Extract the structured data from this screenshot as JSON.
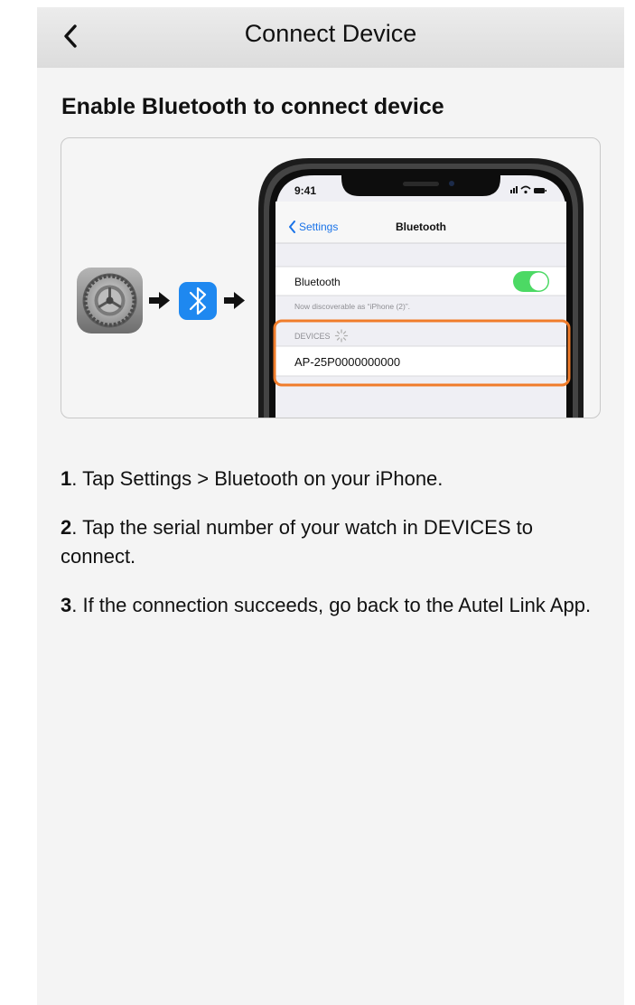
{
  "navbar": {
    "title": "Connect Device",
    "back_icon": "chevron-left-icon"
  },
  "heading": "Enable Bluetooth to connect device",
  "illustration": {
    "icons": [
      "settings-gear-icon",
      "arrow-right-icon",
      "bluetooth-icon",
      "arrow-right-icon"
    ],
    "phone": {
      "time": "9:41",
      "back_label": "Settings",
      "screen_title": "Bluetooth",
      "bluetooth_row_label": "Bluetooth",
      "bluetooth_enabled": true,
      "discoverable_text": "Now discoverable as “iPhone (2)”.",
      "devices_header": "DEVICES",
      "device_name": "AP-25P0000000000",
      "highlight_color": "#f07c2a",
      "toggle_color": "#4cd964"
    }
  },
  "steps": [
    {
      "num": "1",
      "text": ". Tap Settings > Bluetooth on your iPhone."
    },
    {
      "num": "2",
      "text": ". Tap the serial number of your watch in DEVICES to connect."
    },
    {
      "num": "3",
      "text": ". If the connection succeeds, go back to the Autel Link App."
    }
  ]
}
